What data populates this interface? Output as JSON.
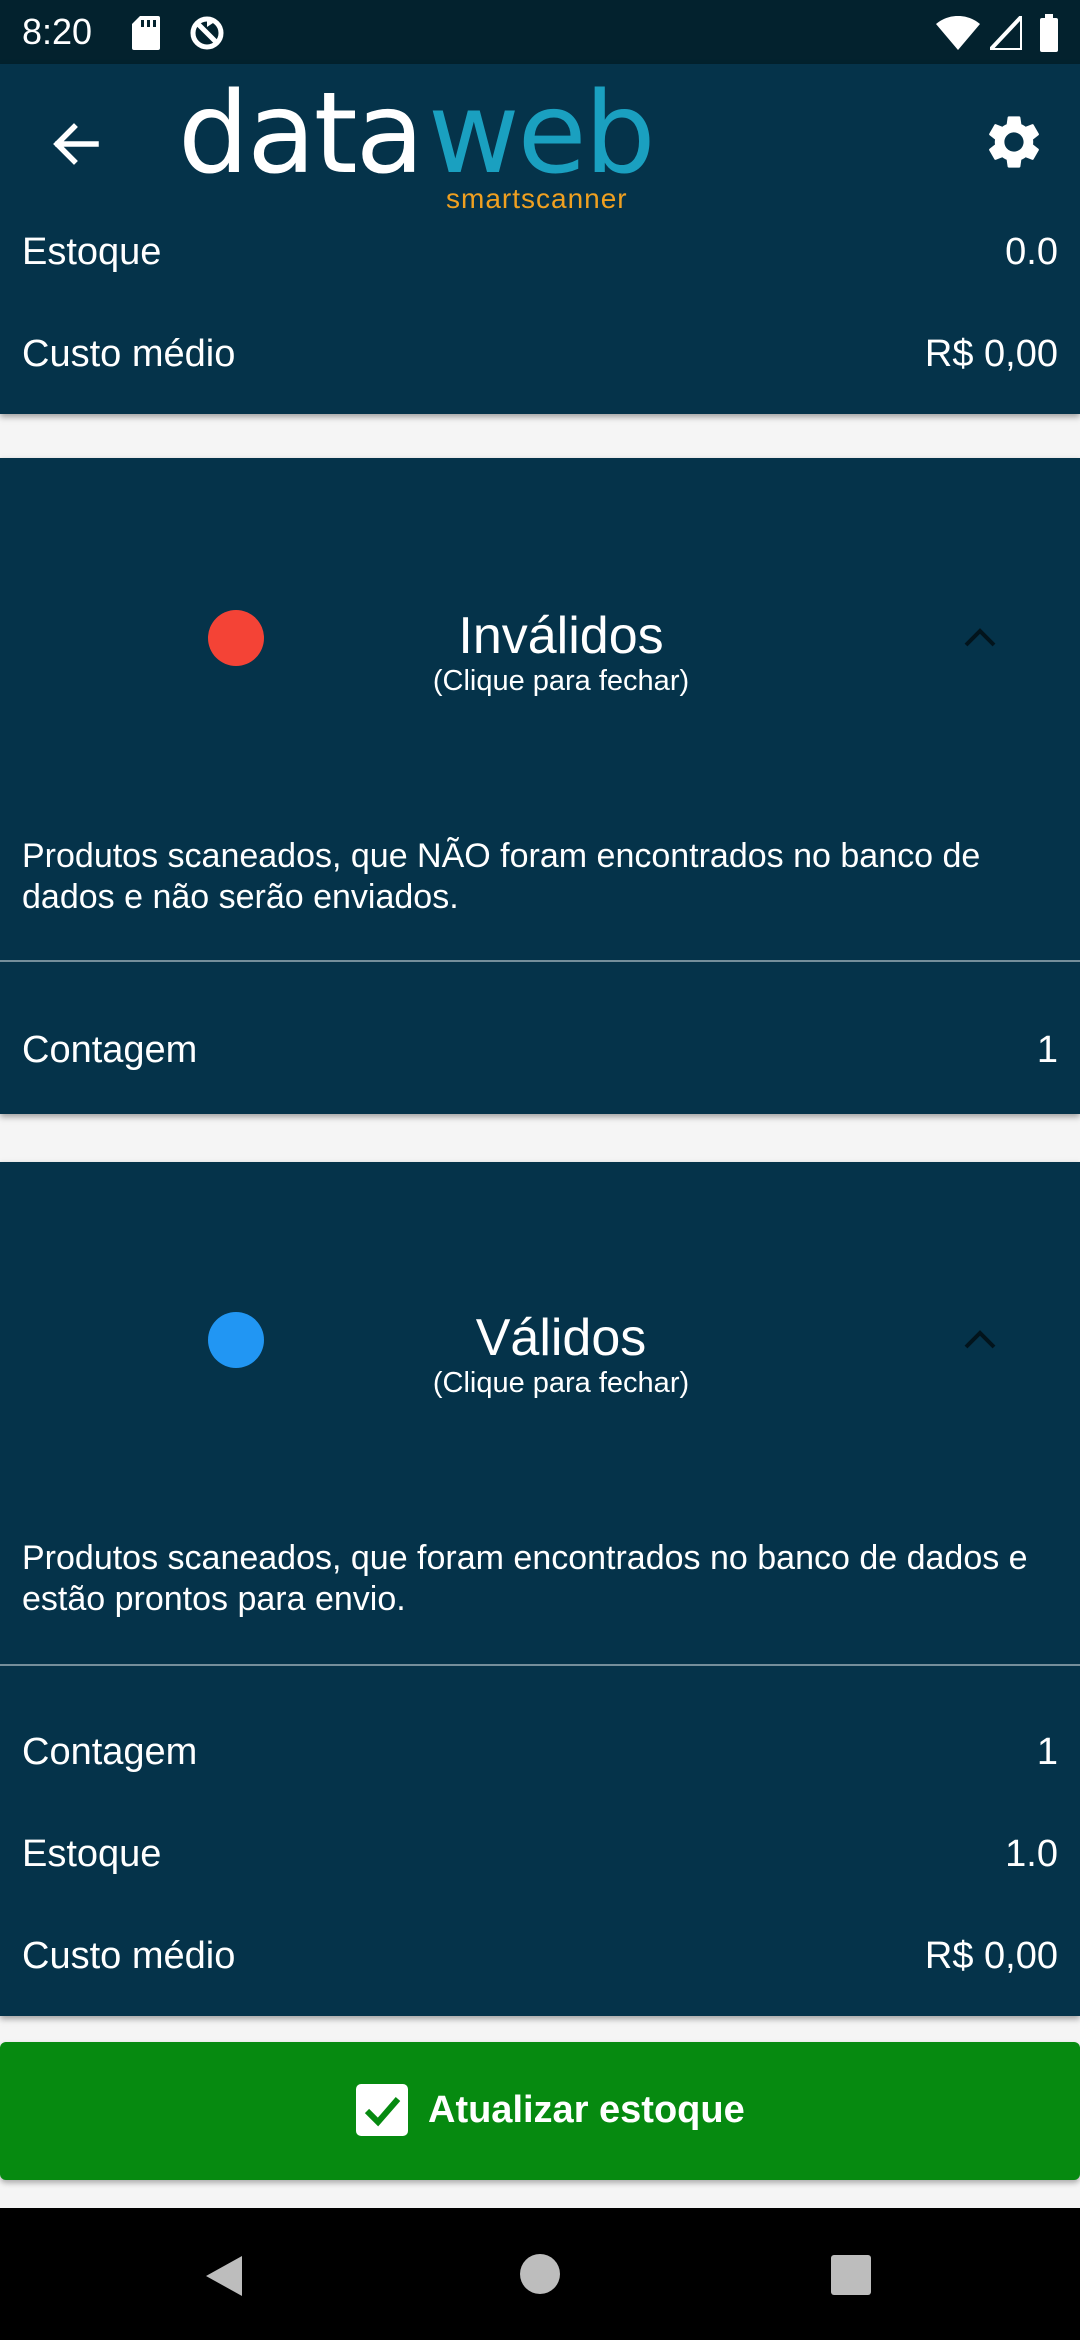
{
  "status_bar": {
    "time": "8:20",
    "icons": [
      "sd-card-icon",
      "sync-icon",
      "wifi-icon",
      "signal-icon",
      "battery-icon"
    ]
  },
  "header": {
    "logo": {
      "part1": "data",
      "part2": "web",
      "subtitle": "smartscanner"
    },
    "back_icon": "arrow-left-icon",
    "settings_icon": "gear-icon",
    "rows": [
      {
        "label": "Estoque",
        "value": "0.0"
      },
      {
        "label": "Custo médio",
        "value": "R$ 0,00"
      }
    ]
  },
  "cards": [
    {
      "title": "Inválidos",
      "subtitle": "(Clique para fechar)",
      "dot_color": "#f44336",
      "description": "Produtos scaneados, que NÃO foram encontrados no banco de dados e não serão enviados.",
      "rows": [
        {
          "label": "Contagem",
          "value": "1"
        }
      ]
    },
    {
      "title": "Válidos",
      "subtitle": "(Clique para fechar)",
      "dot_color": "#2196f3",
      "description": "Produtos scaneados, que foram encontrados no banco de dados e estão prontos para envio.",
      "rows": [
        {
          "label": "Contagem",
          "value": "1"
        },
        {
          "label": "Estoque",
          "value": "1.0"
        },
        {
          "label": "Custo médio",
          "value": "R$ 0,00"
        }
      ]
    }
  ],
  "action_button": {
    "label": "Atualizar estoque",
    "color": "#068a10"
  },
  "colors": {
    "primary_dark": "#05334a",
    "status_bar": "#03222e",
    "logo_accent": "#1aa0c0",
    "logo_sub": "#f0a020"
  },
  "nav_bar": {
    "icons": [
      "nav-back-icon",
      "nav-home-icon",
      "nav-recent-icon"
    ]
  }
}
